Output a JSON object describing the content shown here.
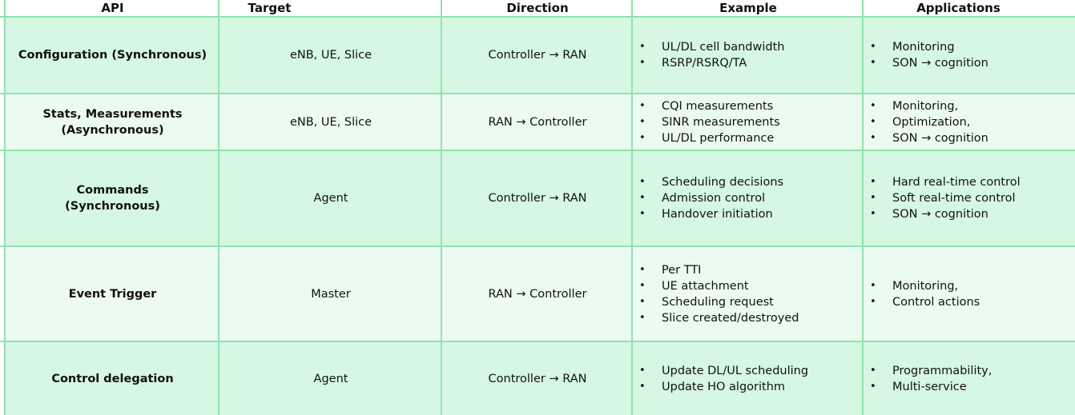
{
  "headers": {
    "api": "API",
    "target": "Target",
    "direction": "Direction",
    "example": "Example",
    "applications": "Applications"
  },
  "rows": [
    {
      "api": "Configuration (Synchronous)",
      "target": "eNB, UE, Slice",
      "direction": "Controller → RAN",
      "example": [
        "UL/DL cell bandwidth",
        "RSRP/RSRQ/TA"
      ],
      "applications": [
        "Monitoring",
        "SON → cognition"
      ]
    },
    {
      "api": "Stats, Measurements (Asynchronous)",
      "target": "eNB, UE, Slice",
      "direction": "RAN → Controller",
      "example": [
        "CQI measurements",
        "SINR measurements",
        "UL/DL performance"
      ],
      "applications": [
        "Monitoring,",
        "Optimization,",
        "SON → cognition"
      ]
    },
    {
      "api": "Commands (Synchronous)",
      "target": "Agent",
      "direction": "Controller → RAN",
      "example": [
        "Scheduling decisions",
        "Admission control",
        "Handover initiation"
      ],
      "applications": [
        "Hard real-time control",
        "Soft real-time control",
        "SON → cognition"
      ]
    },
    {
      "api": "Event Trigger",
      "target": "Master",
      "direction": "RAN → Controller",
      "example": [
        "Per TTI",
        "UE attachment",
        "Scheduling request",
        "Slice created/destroyed"
      ],
      "applications": [
        "Monitoring,",
        "Control actions"
      ]
    },
    {
      "api": "Control delegation",
      "target": "Agent",
      "direction": "Controller → RAN",
      "example": [
        "Update DL/UL scheduling",
        "Update HO algorithm"
      ],
      "applications": [
        "Programmability,",
        "Multi-service"
      ]
    }
  ],
  "colors": {
    "row_dark": "#d6f7e2",
    "row_light": "#ecfbf2",
    "border": "#8fe3ae"
  }
}
